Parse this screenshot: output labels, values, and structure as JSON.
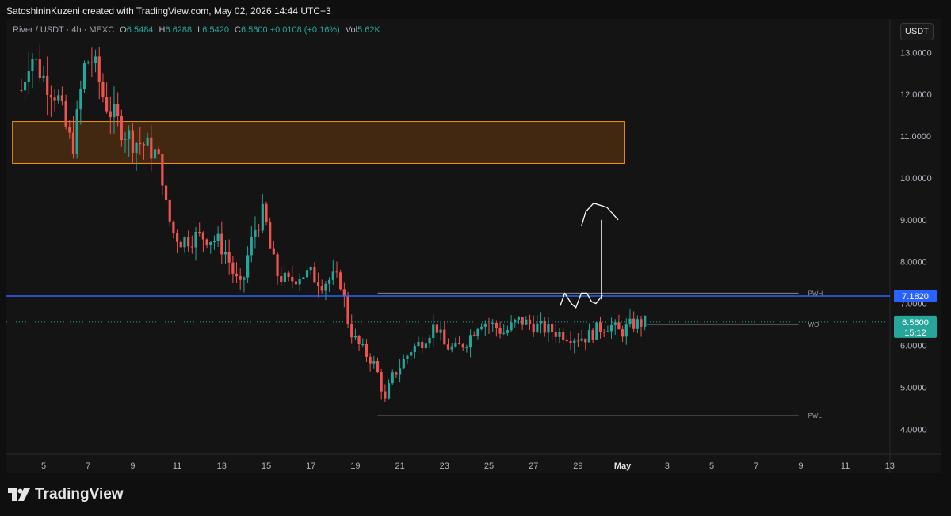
{
  "credit": "SatoshininKuzeni created with TradingView.com, May 02, 2026 14:44 UTC+3",
  "header": {
    "symbol": "River / USDT · 4h · MEXC",
    "o_label": "O",
    "o_value": "6.5484",
    "h_label": "H",
    "h_value": "6.6288",
    "l_label": "L",
    "l_value": "6.5420",
    "c_label": "C",
    "c_value": "6.5600",
    "change": "+0.0108 (+0.16%)",
    "vol_label": "Vol",
    "vol_value": "5.62K",
    "currency": "USDT"
  },
  "brand": {
    "name": "TradingView",
    "icon": "tradingview-logo-icon"
  },
  "colors": {
    "up": "#26a69a",
    "down": "#ef5350",
    "zone_fill": "#4a2a10",
    "zone_stroke": "#f7931a",
    "hline": "#2962ff",
    "ref_line": "#c7c7c7"
  },
  "chart_data": {
    "type": "candlestick",
    "ylim": [
      3.4,
      13.8
    ],
    "yticks": [
      "13.0000",
      "12.0000",
      "11.0000",
      "10.0000",
      "9.0000",
      "8.0000",
      "7.0000",
      "6.0000",
      "5.0000",
      "4.0000"
    ],
    "xticks": [
      "5",
      "7",
      "9",
      "11",
      "13",
      "15",
      "17",
      "19",
      "21",
      "23",
      "25",
      "27",
      "29",
      "May",
      "3",
      "5",
      "7",
      "9",
      "11",
      "13"
    ],
    "price_path": [
      [
        4.0,
        12.1
      ],
      [
        4.4,
        13.0
      ],
      [
        5.0,
        12.4
      ],
      [
        5.6,
        12.0
      ],
      [
        6.0,
        11.2
      ],
      [
        6.3,
        10.7
      ],
      [
        6.5,
        11.4
      ],
      [
        6.8,
        12.6
      ],
      [
        7.1,
        12.9
      ],
      [
        7.4,
        12.5
      ],
      [
        7.7,
        11.9
      ],
      [
        8.0,
        11.6
      ],
      [
        8.5,
        11.2
      ],
      [
        9.0,
        10.9
      ],
      [
        9.5,
        10.8
      ],
      [
        10.0,
        10.6
      ],
      [
        10.3,
        10.2
      ],
      [
        10.5,
        9.3
      ],
      [
        10.8,
        8.7
      ],
      [
        11.2,
        8.5
      ],
      [
        11.8,
        8.6
      ],
      [
        12.3,
        8.6
      ],
      [
        12.8,
        8.5
      ],
      [
        13.2,
        8.2
      ],
      [
        13.6,
        7.6
      ],
      [
        13.9,
        7.3
      ],
      [
        14.1,
        8.0
      ],
      [
        14.5,
        8.8
      ],
      [
        14.9,
        9.2
      ],
      [
        15.2,
        8.2
      ],
      [
        15.5,
        7.7
      ],
      [
        16.0,
        7.5
      ],
      [
        16.5,
        7.7
      ],
      [
        17.0,
        7.7
      ],
      [
        17.5,
        7.5
      ],
      [
        18.0,
        7.6
      ],
      [
        18.4,
        7.5
      ],
      [
        18.6,
        6.7
      ],
      [
        18.9,
        6.2
      ],
      [
        19.3,
        5.9
      ],
      [
        19.8,
        5.6
      ],
      [
        20.1,
        5.2
      ],
      [
        20.3,
        4.6
      ],
      [
        20.6,
        5.2
      ],
      [
        21.0,
        5.5
      ],
      [
        21.5,
        5.9
      ],
      [
        22.0,
        6.1
      ],
      [
        22.6,
        6.5
      ],
      [
        23.0,
        6.0
      ],
      [
        23.5,
        5.9
      ],
      [
        24.0,
        6.1
      ],
      [
        24.6,
        6.6
      ],
      [
        25.1,
        6.5
      ],
      [
        25.7,
        6.3
      ],
      [
        26.3,
        6.6
      ],
      [
        26.9,
        6.5
      ],
      [
        27.5,
        6.4
      ],
      [
        28.1,
        6.3
      ],
      [
        28.8,
        6.2
      ],
      [
        29.4,
        6.2
      ],
      [
        29.9,
        6.4
      ],
      [
        30.4,
        6.5
      ],
      [
        30.9,
        6.3
      ],
      [
        31.4,
        6.5
      ],
      [
        32.1,
        6.56
      ]
    ],
    "zone": {
      "x_start": 3.6,
      "x_end": 31.1,
      "y_low": 10.35,
      "y_high": 11.35
    },
    "horizontal_line": {
      "price": 7.182,
      "label": "7.1820"
    },
    "levels": [
      {
        "label": "PWH",
        "price": 7.25,
        "x_start": 20.0,
        "x_end": 38.9
      },
      {
        "label": "WO",
        "price": 6.5,
        "x_start": 32.1,
        "x_end": 38.9
      },
      {
        "label": "PWL",
        "price": 4.33,
        "x_start": 20.0,
        "x_end": 38.9
      }
    ],
    "last_price": {
      "label": "6.5600",
      "countdown": "15:12",
      "price": 6.56
    },
    "drawing": {
      "squiggle": [
        [
          28.2,
          6.95
        ],
        [
          28.4,
          7.25
        ],
        [
          28.7,
          7.0
        ],
        [
          28.9,
          6.9
        ],
        [
          29.15,
          7.25
        ],
        [
          29.4,
          7.25
        ],
        [
          29.6,
          7.05
        ],
        [
          29.8,
          7.0
        ],
        [
          30.1,
          7.2
        ]
      ],
      "arrow": [
        [
          30.05,
          7.1
        ],
        [
          30.05,
          9.0
        ]
      ],
      "curve": [
        [
          29.15,
          8.85
        ],
        [
          29.35,
          9.2
        ],
        [
          29.7,
          9.4
        ],
        [
          30.3,
          9.3
        ],
        [
          30.8,
          9.0
        ]
      ]
    }
  }
}
